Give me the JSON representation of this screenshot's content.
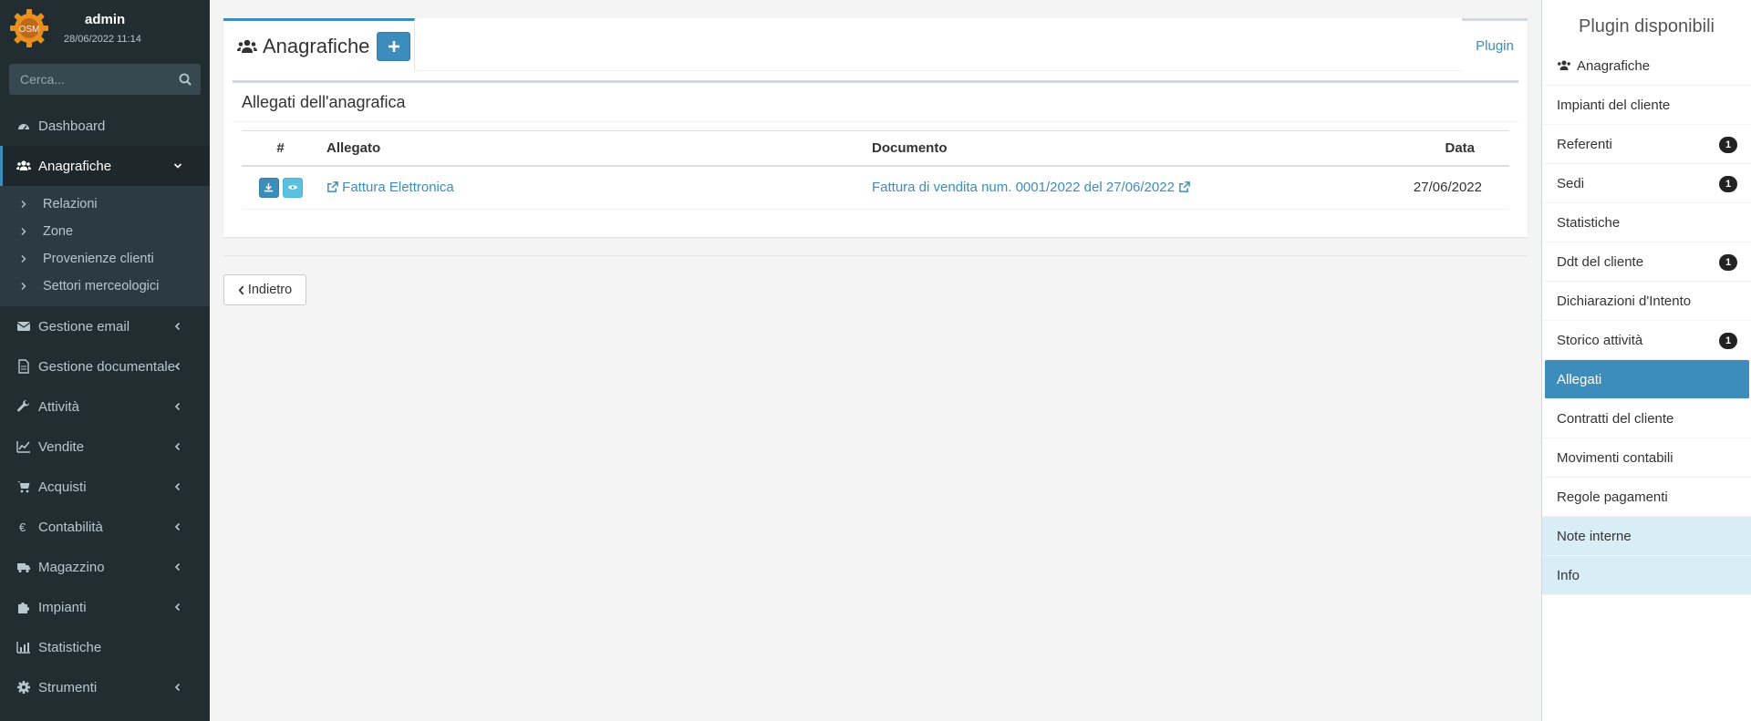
{
  "user": {
    "name": "admin",
    "datetime": "28/06/2022 11:14",
    "logo_text": "OSM"
  },
  "search": {
    "placeholder": "Cerca..."
  },
  "menu": {
    "dashboard": "Dashboard",
    "anagrafiche": "Anagrafiche",
    "submenu": [
      "Relazioni",
      "Zone",
      "Provenienze clienti",
      "Settori merceologici"
    ],
    "email": "Gestione email",
    "documentale": "Gestione documentale",
    "attivita": "Attività",
    "vendite": "Vendite",
    "acquisti": "Acquisti",
    "contabilita": "Contabilità",
    "magazzino": "Magazzino",
    "impianti": "Impianti",
    "statistiche": "Statistiche",
    "strumenti": "Strumenti"
  },
  "tabs": {
    "title": "Anagrafiche",
    "plugin": "Plugin"
  },
  "attachments": {
    "title": "Allegati dell'anagrafica",
    "headers": [
      "#",
      "Allegato",
      "Documento",
      "Data"
    ],
    "rows": [
      {
        "allegato": "Fattura Elettronica",
        "documento": "Fattura di vendita num. 0001/2022 del 27/06/2022",
        "data": "27/06/2022"
      }
    ]
  },
  "back_label": "Indietro",
  "plugins": {
    "title": "Plugin disponibili",
    "items": [
      {
        "label": "Anagrafiche"
      },
      {
        "label": "Impianti del cliente"
      },
      {
        "label": "Referenti",
        "badge": "1"
      },
      {
        "label": "Sedi",
        "badge": "1"
      },
      {
        "label": "Statistiche"
      },
      {
        "label": "Ddt del cliente",
        "badge": "1"
      },
      {
        "label": "Dichiarazioni d'Intento"
      },
      {
        "label": "Storico attività",
        "badge": "1"
      },
      {
        "label": "Allegati"
      },
      {
        "label": "Contratti del cliente"
      },
      {
        "label": "Movimenti contabili"
      },
      {
        "label": "Regole pagamenti"
      },
      {
        "label": "Note interne"
      },
      {
        "label": "Info"
      }
    ]
  },
  "colors": {
    "accent": "#3c8dbc",
    "sidebar": "#222d32",
    "info": "#5bc0de",
    "info_light": "#d9edf7"
  }
}
